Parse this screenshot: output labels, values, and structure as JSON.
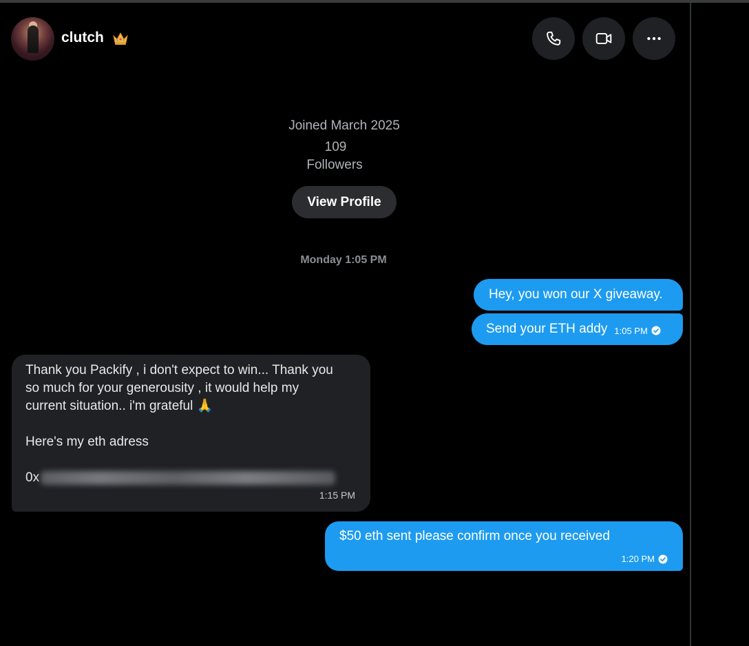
{
  "header": {
    "username": "clutch",
    "crown_icon": "crown-emoji",
    "buttons": [
      {
        "name": "call",
        "icon": "phone-icon"
      },
      {
        "name": "video",
        "icon": "video-icon"
      },
      {
        "name": "more",
        "icon": "more-horizontal-icon"
      }
    ]
  },
  "profile": {
    "joined": "Joined March 2025",
    "followers_count": "109",
    "followers_label": "Followers",
    "view_profile_label": "View Profile"
  },
  "conversation": {
    "day_stamp": "Monday 1:05 PM",
    "messages": [
      {
        "direction": "outgoing",
        "text": "Hey, you won our X giveaway."
      },
      {
        "direction": "outgoing",
        "text": "Send your ETH addy",
        "time": "1:05 PM"
      },
      {
        "direction": "incoming",
        "lines": [
          "Thank you Packify , i don't expect to win... Thank you",
          "so much for your generousity , it would help my",
          "current situation.. i'm grateful"
        ],
        "emoji": "folded-hands-emoji",
        "line4": "Here's my eth adress",
        "address_prefix": "0x",
        "address_blurred": true,
        "time": "1:15 PM"
      },
      {
        "direction": "outgoing",
        "text": "$50 eth sent please confirm once you received",
        "time": "1:20 PM"
      }
    ]
  },
  "colors": {
    "background": "#000000",
    "outgoing_bubble": "#1d9bf0",
    "incoming_bubble": "#202124",
    "muted_text": "#b0b3b8"
  }
}
